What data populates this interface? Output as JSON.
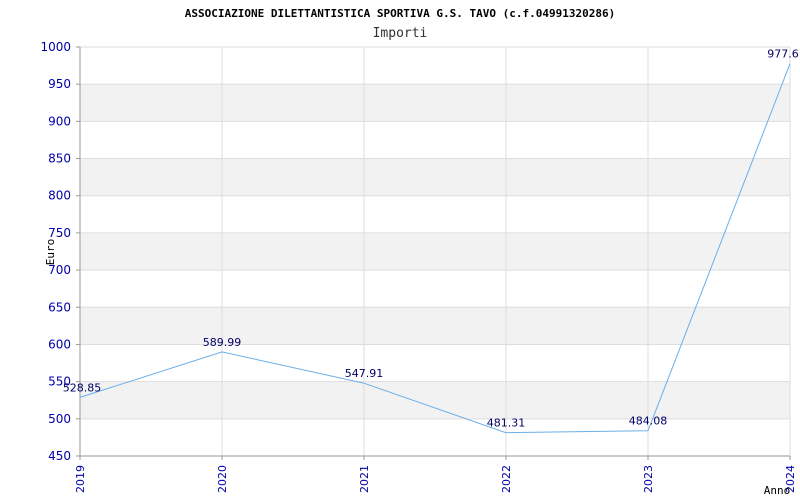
{
  "chart_data": {
    "type": "line",
    "title": "ASSOCIAZIONE DILETTANTISTICA SPORTIVA G.S. TAVO (c.f.04991320286)",
    "subtitle": "Importi",
    "xlabel": "Anno",
    "ylabel": "Euro",
    "categories": [
      "2019",
      "2020",
      "2021",
      "2022",
      "2023",
      "2024"
    ],
    "series": [
      {
        "values": [
          528.85,
          589.99,
          547.91,
          481.31,
          484.08,
          977.6
        ],
        "labels": [
          "528.85",
          "589.99",
          "547.91",
          "481.31",
          "484.08",
          "977.6"
        ],
        "color": "#6aaee8"
      }
    ],
    "ylim": [
      450,
      1000
    ],
    "yticks": [
      "450",
      "500",
      "550",
      "600",
      "650",
      "700",
      "750",
      "800",
      "850",
      "900",
      "950",
      "1000"
    ],
    "grid": true,
    "band_color": "#f2f2f2",
    "grid_color": "#dddddd",
    "tick_color": "#0000aa"
  }
}
